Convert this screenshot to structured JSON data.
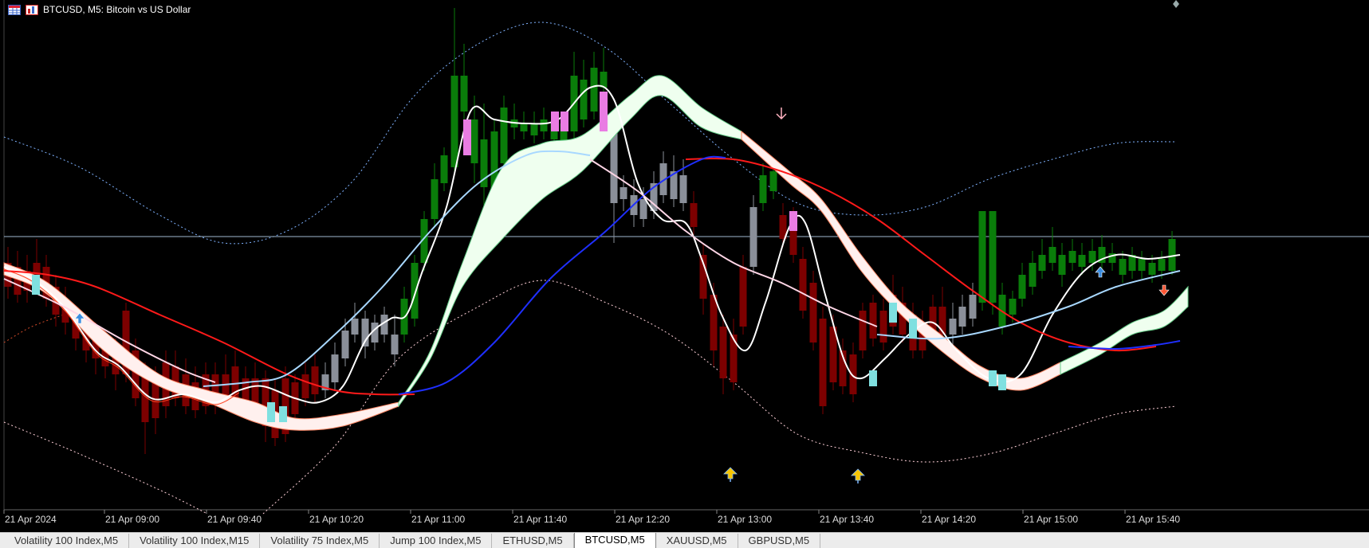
{
  "window": {
    "symbol_title": "BTCUSD, M5:  Bitcoin vs US Dollar",
    "icons": [
      "grid-table-icon",
      "chart-toggle-icon"
    ]
  },
  "colors": {
    "background": "#000000",
    "bull_candle": "#0a7d0a",
    "bear_candle": "#7d0000",
    "neutral_candle": "#8a8f99",
    "red_ma": "#ff1a1a",
    "blue_ma": "#1f2fff",
    "light_blue_ma": "#a8d8ff",
    "pink_ma": "#ffd6e6",
    "band_upper": "#7fb2ff",
    "band_lower": "#ffd0d8",
    "ribbon_bull": "#efffef",
    "ribbon_bear": "#fff0ee",
    "crosshair": "#9fb7d0"
  },
  "time_axis": {
    "labels": [
      "21 Apr 2024",
      "21 Apr 09:00",
      "21 Apr 09:40",
      "21 Apr 10:20",
      "21 Apr 11:00",
      "21 Apr 11:40",
      "21 Apr 12:20",
      "21 Apr 13:00",
      "21 Apr 13:40",
      "21 Apr 14:20",
      "21 Apr 15:00",
      "21 Apr 15:40"
    ]
  },
  "tabs": [
    {
      "label": "Volatility 100 Index,M5",
      "active": false
    },
    {
      "label": "Volatility 100 Index,M15",
      "active": false
    },
    {
      "label": "Volatility 75 Index,M5",
      "active": false
    },
    {
      "label": "Jump 100 Index,M5",
      "active": false
    },
    {
      "label": "ETHUSD,M5",
      "active": false
    },
    {
      "label": "BTCUSD,M5",
      "active": true
    },
    {
      "label": "XAUUSD,M5",
      "active": false
    },
    {
      "label": "GBPUSD,M5",
      "active": false
    }
  ]
}
